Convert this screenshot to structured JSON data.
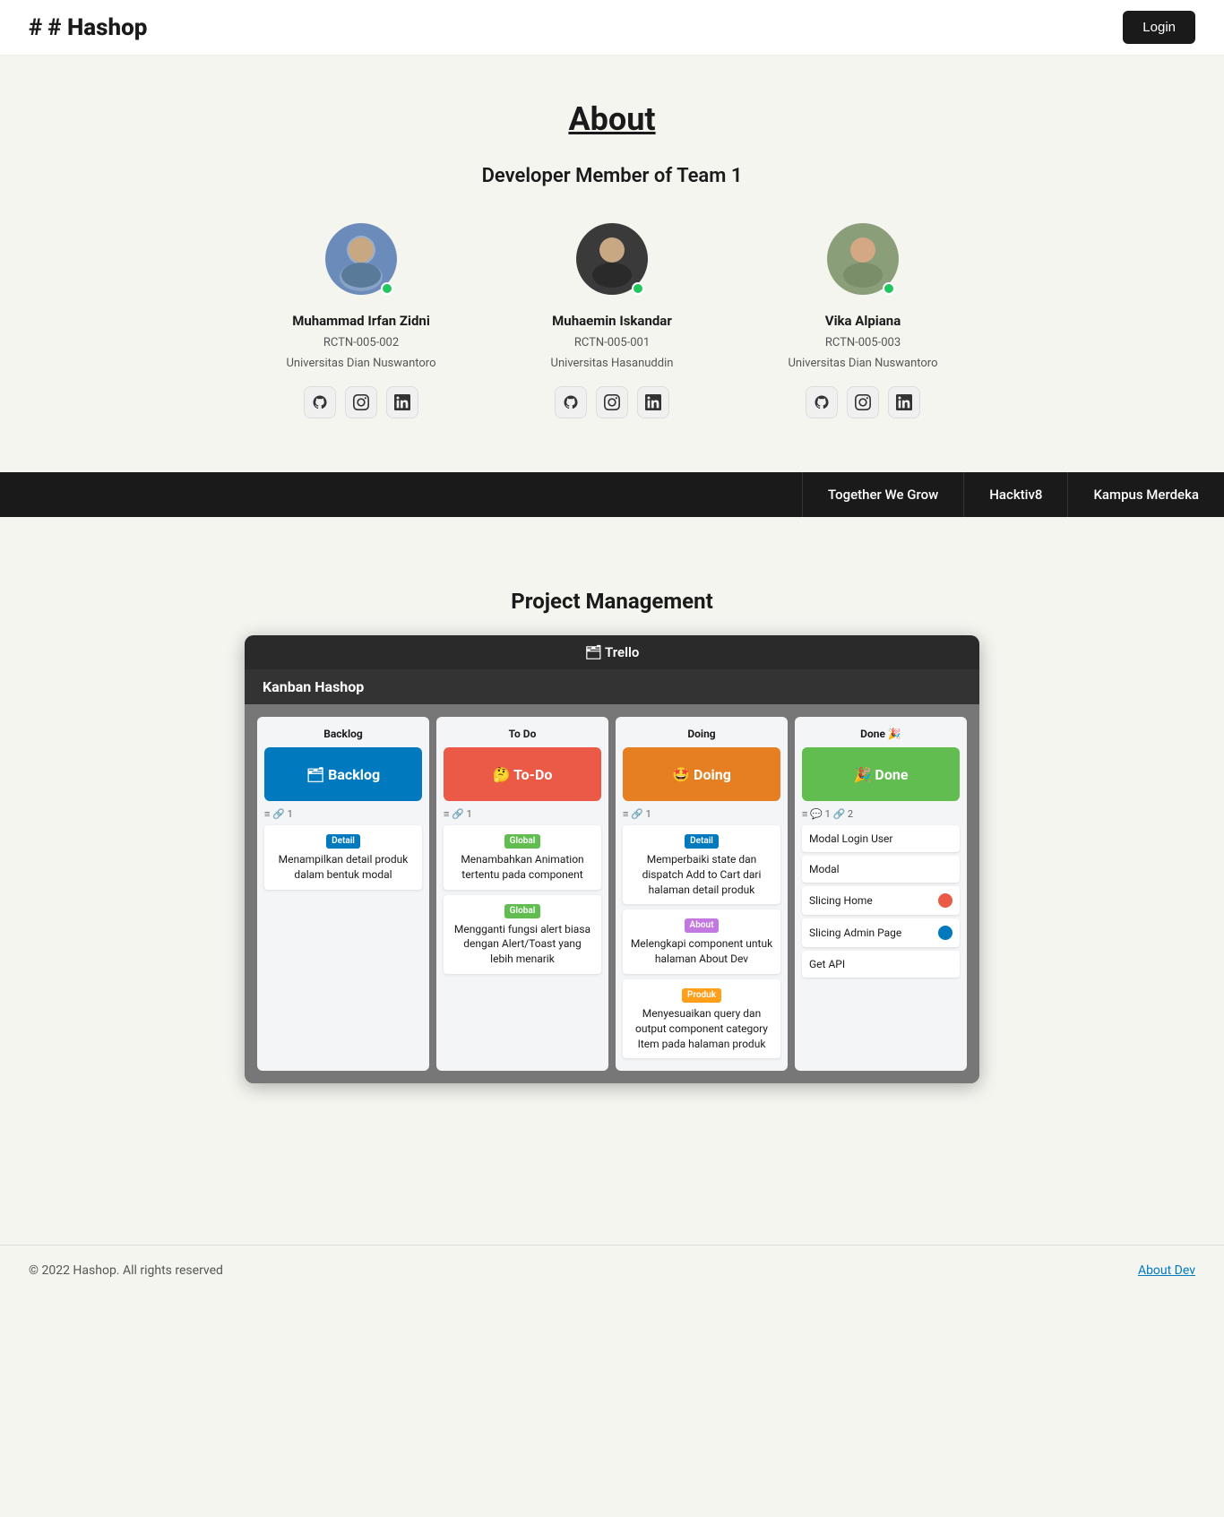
{
  "navbar": {
    "brand": "# Hashop",
    "login_label": "Login"
  },
  "about": {
    "title": "About",
    "team_title": "Developer Member of Team 1",
    "members": [
      {
        "name": "Muhammad Irfan Zidni",
        "id": "RCTN-005-002",
        "university": "Universitas Dian Nuswantoro",
        "online": true,
        "avatar_color": "#6b8cba"
      },
      {
        "name": "Muhaemin Iskandar",
        "id": "RCTN-005-001",
        "university": "Universitas Hasanuddin",
        "online": true,
        "avatar_color": "#4a4a4a"
      },
      {
        "name": "Vika Alpiana",
        "id": "RCTN-005-003",
        "university": "Universitas Dian Nuswantoro",
        "online": true,
        "avatar_color": "#8b9e7a"
      }
    ]
  },
  "tagline": {
    "items": [
      "Together We Grow",
      "Hacktiv8",
      "Kampus Merdeka"
    ]
  },
  "project_management": {
    "title": "Project Management",
    "trello_label": "🗂 Trello",
    "board_title": "Kanban Hashop",
    "columns": [
      {
        "title": "Backlog",
        "banner_emoji": "🗂",
        "banner_text": "Backlog",
        "banner_class": "blue",
        "meta": "≡ 🔗 1",
        "cards": [
          {
            "label": "Detail",
            "label_class": "label-detail",
            "text": "Menampilkan detail produk dalam bentuk modal"
          }
        ]
      },
      {
        "title": "To Do",
        "banner_emoji": "🤔",
        "banner_text": "To-Do",
        "banner_class": "red",
        "meta": "≡ 🔗 1",
        "cards": [
          {
            "label": "Global",
            "label_class": "label-global",
            "text": "Menambahkan Animation tertentu pada component"
          },
          {
            "label": "Global",
            "label_class": "label-global",
            "text": "Mengganti fungsi alert biasa dengan Alert/Toast yang lebih menarik"
          }
        ]
      },
      {
        "title": "Doing",
        "banner_emoji": "🤩",
        "banner_text": "Doing",
        "banner_class": "orange",
        "meta": "≡ 🔗 1",
        "cards": [
          {
            "label": "Detail",
            "label_class": "label-detail",
            "text": "Memperbaiki state dan dispatch Add to Cart dari halaman detail produk"
          },
          {
            "label": "About",
            "label_class": "label-about",
            "text": "Melengkapi component untuk halaman About Dev"
          },
          {
            "label": "Produk",
            "label_class": "label-produk",
            "text": "Menyesuaikan query dan output component category Item pada halaman produk"
          }
        ]
      },
      {
        "title": "Done 🎉",
        "banner_emoji": "🎉",
        "banner_text": "Done",
        "banner_class": "green",
        "meta": "≡ 💬 1 🔗 2",
        "done_items": [
          {
            "text": "Modal Login User",
            "badge_class": ""
          },
          {
            "text": "Modal",
            "badge_class": ""
          },
          {
            "text": "Slicing Home",
            "badge_class": "badge-red"
          },
          {
            "text": "Slicing Admin Page",
            "badge_class": "badge-blue"
          },
          {
            "text": "Get API",
            "badge_class": ""
          }
        ]
      }
    ]
  },
  "footer": {
    "copyright": "© 2022 Hashop. All rights reserved",
    "link_text": "About Dev"
  }
}
